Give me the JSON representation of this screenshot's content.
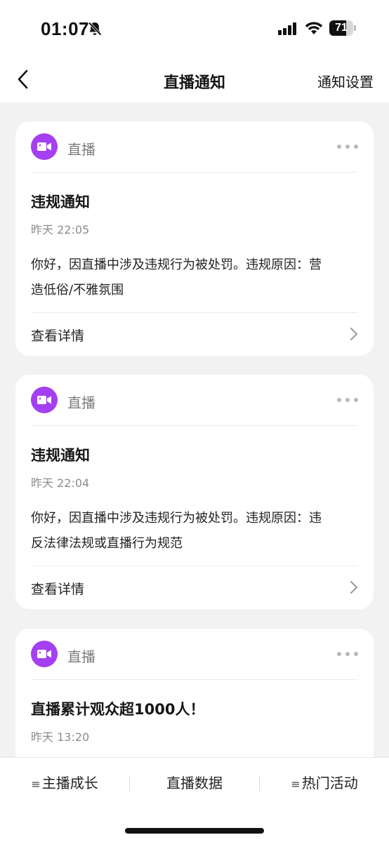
{
  "status_bar": {
    "time": "01:07",
    "battery_percent": "71",
    "battery_level": 0.71,
    "icons": [
      "bell-slash-icon",
      "signal-icon",
      "wifi-icon",
      "battery-icon"
    ]
  },
  "nav": {
    "title": "直播通知",
    "action_label": "通知设置",
    "back_icon": "chevron-left-icon"
  },
  "colors": {
    "channel_accent": "#a43ff2",
    "background": "#f2f2f2"
  },
  "cards": [
    {
      "channel": "直播",
      "title": "违规通知",
      "time": "昨天 22:05",
      "body_line1": "你好，因直播中涉及违规行为被处罚。违规原因：营",
      "body_line2": "造低俗/不雅氛围",
      "footer_label": "查看详情"
    },
    {
      "channel": "直播",
      "title": "违规通知",
      "time": "昨天 22:04",
      "body_line1": "你好，因直播中涉及违规行为被处罚。违规原因：违",
      "body_line2": "反法律法规或直播行为规范",
      "footer_label": "查看详情"
    },
    {
      "channel": "直播",
      "title": "直播累计观众超1000人！",
      "time": "昨天 13:20"
    }
  ],
  "bottom_bar": {
    "menu_glyph": "≡",
    "tabs": [
      {
        "label": "主播成长",
        "has_menu": true
      },
      {
        "label": "直播数据",
        "has_menu": false
      },
      {
        "label": "热门活动",
        "has_menu": true
      }
    ]
  }
}
